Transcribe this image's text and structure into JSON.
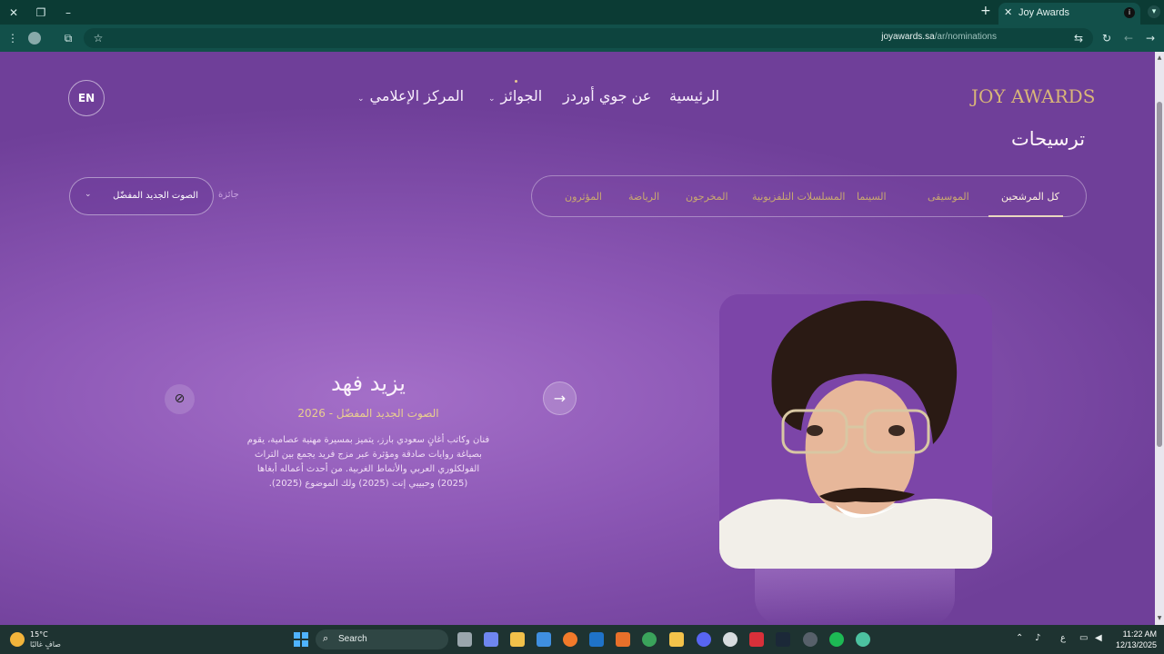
{
  "browser": {
    "tab_title": "Joy Awards",
    "url_host": "joyawards.sa",
    "url_path": "/ar/nominations"
  },
  "site": {
    "brand": "JOY AWARDS",
    "nav": {
      "home": "الرئيسية",
      "about": "عن جوي أوردز",
      "awards": "الجوائز",
      "media": "المركز الإعلامي"
    },
    "lang_button": "EN",
    "page_heading": "ترسيحات"
  },
  "filters": {
    "tabs": [
      "كل المرشحين",
      "الموسيقى",
      "السينما",
      "المسلسلات التلفزيونية",
      "المخرجون",
      "الرياضة",
      "المؤثرون"
    ],
    "active_tab_index": 0,
    "award_label": "جائزة",
    "award_selected": "الصوت الجديد المفضّل"
  },
  "nominee": {
    "name": "يزيد فهد",
    "category_year": "الصوت الجديد المفضّل - 2026",
    "description": "فنان وكاتب أغانٍ سعودي بارز، يتميز بمسيرة مهنية عصامية، يقوم بصياغة روايات صادقة ومؤثرة عبر مزج فريد يجمع بين التراث الفولكلوري العربي والأنماط الغربية. من أحدث أعماله أبغاها (2025) وحبيبي إنت (2025) ولك الموضوع (2025)."
  },
  "taskbar": {
    "temperature": "15°C",
    "condition": "صافٍ غالبًا",
    "search_label": "Search",
    "time": "11:22 AM",
    "date": "12/13/2025",
    "lang_indicator": "ع"
  },
  "colors": {
    "chrome": "#0b3b34",
    "page_purple": "#8d58b6",
    "gold": "#d9b678"
  }
}
